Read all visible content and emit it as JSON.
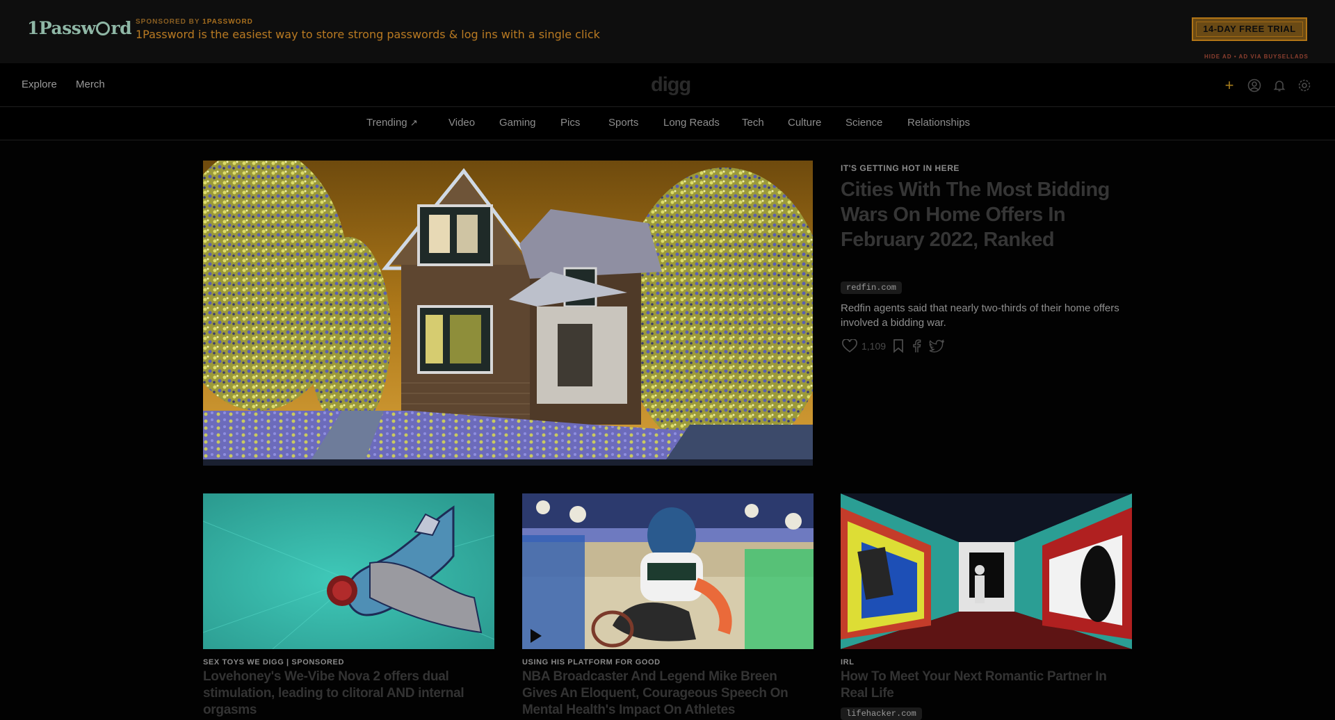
{
  "ad": {
    "logo": "1Passw",
    "logo_tail": "rd",
    "sponsored_prefix": "SPONSORED BY",
    "sponsor_name": "1PASSWORD",
    "text": "1Password is the easiest way to store strong passwords & log ins with a single click",
    "cta": "14-DAY FREE TRIAL",
    "hide": "HIDE AD • AD VIA BUYSELLADS"
  },
  "nav": {
    "explore": "Explore",
    "merch": "Merch",
    "logo": "digg"
  },
  "categories": [
    "Trending",
    "Video",
    "Gaming",
    "Pics",
    "Sports",
    "Long Reads",
    "Tech",
    "Culture",
    "Science",
    "Relationships"
  ],
  "hero": {
    "kicker": "IT'S GETTING HOT IN HERE",
    "title": "Cities With The Most Bidding Wars On Home Offers In February 2022, Ranked",
    "domain": "redfin.com",
    "description": "Redfin agents said that nearly two-thirds of their home offers involved a bidding war.",
    "likes": "1,109"
  },
  "cards": [
    {
      "kicker": "SEX TOYS WE DIGG | SPONSORED",
      "title": "Lovehoney's We-Vibe Nova 2 offers dual stimulation, leading to clitoral AND internal orgasms"
    },
    {
      "kicker": "USING HIS PLATFORM FOR GOOD",
      "title": "NBA Broadcaster And Legend Mike Breen Gives An Eloquent, Courageous Speech On Mental Health's Impact On Athletes"
    },
    {
      "kicker": "IRL",
      "title": "How To Meet Your Next Romantic Partner In Real Life",
      "domain": "lifehacker.com"
    }
  ],
  "colors": {
    "accent_gold": "#b97a22",
    "brand_green": "#8fb7a6",
    "background": "#020202"
  }
}
